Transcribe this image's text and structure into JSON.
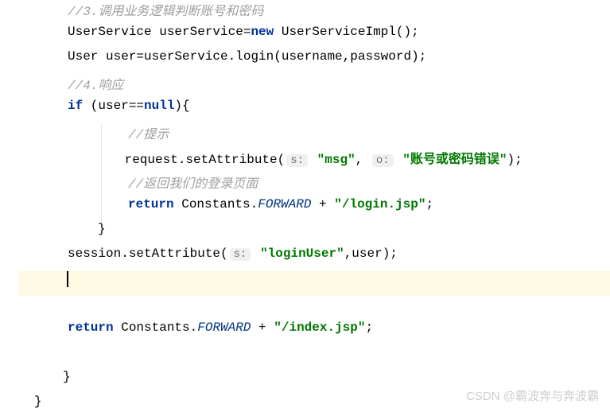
{
  "lines": {
    "l01brace": "}",
    "c1": "//3.调用业务逻辑判断账号和密码",
    "l2a": "UserService userService=",
    "l2b": "new",
    "l2c": " UserServiceImpl();",
    "l3": "User user=userService.login(username,password);",
    "c4": "//4.响应",
    "l5a": "if",
    "l5b": " (user==",
    "l5c": "null",
    "l5d": "){",
    "c6": "//提示",
    "l7a": " request.setAttribute(",
    "l7b": "s:",
    "l7c": "\"msg\"",
    "l7d": ", ",
    "l7e": "o:",
    "l7f": "\"账号或密码错误\"",
    "l7g": ");",
    "c8": "//返回我们的登录页面",
    "l9a": "return",
    "l9b": " Constants.",
    "l9c": "FORWARD",
    "l9d": " + ",
    "l9e": "\"/login.jsp\"",
    "l9f": ";",
    "l10": "}",
    "l11a": "session.setAttribute(",
    "l11b": "s:",
    "l11c": "\"loginUser\"",
    "l11d": ",user);",
    "l13a": "return",
    "l13b": " Constants.",
    "l13c": "FORWARD",
    "l13d": " + ",
    "l13e": "\"/index.jsp\"",
    "l13f": ";",
    "l15": "}",
    "l16": "}"
  },
  "watermark": "CSDN @霸波奔与奔波霸"
}
